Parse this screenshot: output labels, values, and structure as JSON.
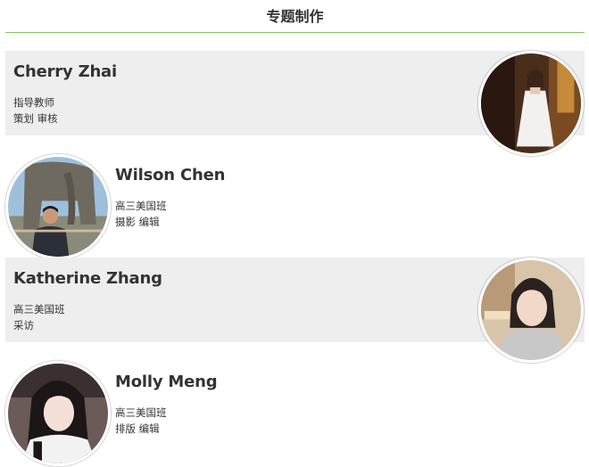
{
  "header": {
    "title": "专题制作"
  },
  "members": [
    {
      "name": "Cherry Zhai",
      "line1": "指导教师",
      "line2": "策划 审核"
    },
    {
      "name": "Wilson Chen",
      "line1": "高三美国班",
      "line2": "摄影 编辑"
    },
    {
      "name": "Katherine Zhang",
      "line1": "高三美国班",
      "line2": "采访"
    },
    {
      "name": "Molly Meng",
      "line1": "高三美国班",
      "line2": "排版 编辑"
    }
  ],
  "colors": {
    "accent_line": "#8cc36a",
    "card_bg": "#eeeeee"
  }
}
